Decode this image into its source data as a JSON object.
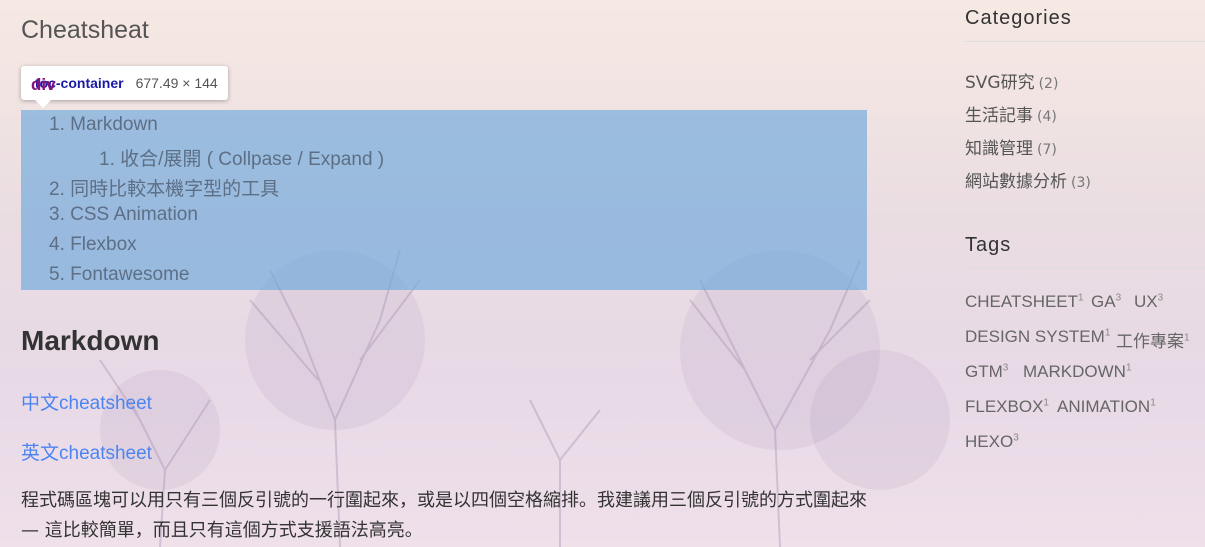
{
  "page": {
    "title": "Cheatsheat"
  },
  "devtools_tooltip": {
    "tag": "div",
    "class": ".toc-container",
    "size": "677.49 × 144"
  },
  "toc": {
    "items": [
      {
        "num": "1.",
        "label": "Markdown"
      },
      {
        "num": "1.",
        "label": "收合/展開 ( Collpase / Expand )"
      },
      {
        "num": "2.",
        "label": "同時比較本機字型的工具"
      },
      {
        "num": "3.",
        "label": "CSS Animation"
      },
      {
        "num": "4.",
        "label": "Flexbox"
      },
      {
        "num": "5.",
        "label": "Fontawesome"
      }
    ]
  },
  "content": {
    "heading": "Markdown",
    "links": [
      "中文cheatsheet",
      "英文cheatsheet"
    ],
    "paragraph": "程式碼區塊可以用只有三個反引號的一行圍起來，或是以四個空格縮排。我建議用三個反引號的方式圍起來 — 這比較簡單，而且只有這個方式支援語法高亮。"
  },
  "sidebar": {
    "categories_title": "Categories",
    "categories": [
      {
        "name": "SVG研究",
        "count": "(2)"
      },
      {
        "name": "生活記事",
        "count": "(4)"
      },
      {
        "name": "知識管理",
        "count": "(7)"
      },
      {
        "name": "網站數據分析",
        "count": "(3)"
      }
    ],
    "tags_title": "Tags",
    "tags": [
      {
        "name": "CHEATSHEET",
        "count": "1"
      },
      {
        "name": "GA",
        "count": "3"
      },
      {
        "name": "UX",
        "count": "3"
      },
      {
        "name": "DESIGN SYSTEM",
        "count": "1"
      },
      {
        "name": "工作專案",
        "count": "1"
      },
      {
        "name": "GTM",
        "count": "3"
      },
      {
        "name": "MARKDOWN",
        "count": "1"
      },
      {
        "name": "FLEXBOX",
        "count": "1"
      },
      {
        "name": "ANIMATION",
        "count": "1"
      },
      {
        "name": "HEXO",
        "count": "3"
      }
    ]
  },
  "colors": {
    "link": "#4d85f0",
    "toc_highlight": "#6fa8dc",
    "selector": "#881280"
  }
}
